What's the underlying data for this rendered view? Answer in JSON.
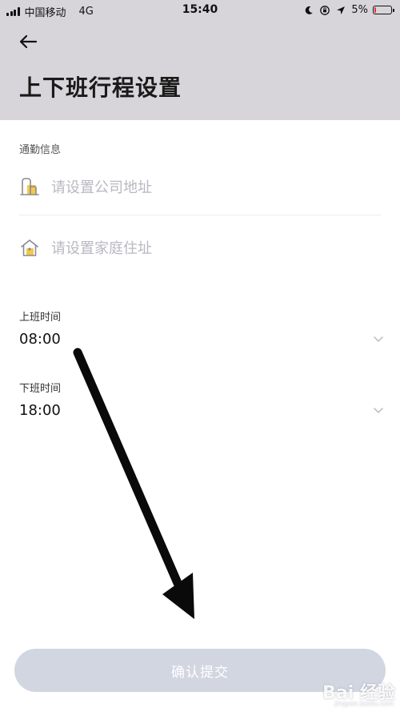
{
  "status_bar": {
    "carrier": "中国移动",
    "network": "4G",
    "time": "15:40",
    "battery": "5%",
    "battery_level": 0.05,
    "battery_color": "#e5322d"
  },
  "header": {
    "back_icon": "arrow-left-icon",
    "title": "上下班行程设置",
    "background": "#d8d5da"
  },
  "commute": {
    "section_label": "通勤信息",
    "company": {
      "icon": "office-building-icon",
      "placeholder": "请设置公司地址"
    },
    "home": {
      "icon": "home-icon",
      "placeholder": "请设置家庭住址"
    }
  },
  "work_start": {
    "label": "上班时间",
    "value": "08:00",
    "icon": "chevron-down-icon"
  },
  "work_end": {
    "label": "下班时间",
    "value": "18:00",
    "icon": "chevron-down-icon"
  },
  "submit": {
    "label": "确认提交",
    "color": "#d2d6e0"
  },
  "watermark": {
    "logo": "Bai 经验",
    "url": "jingyan.baidu.com"
  }
}
